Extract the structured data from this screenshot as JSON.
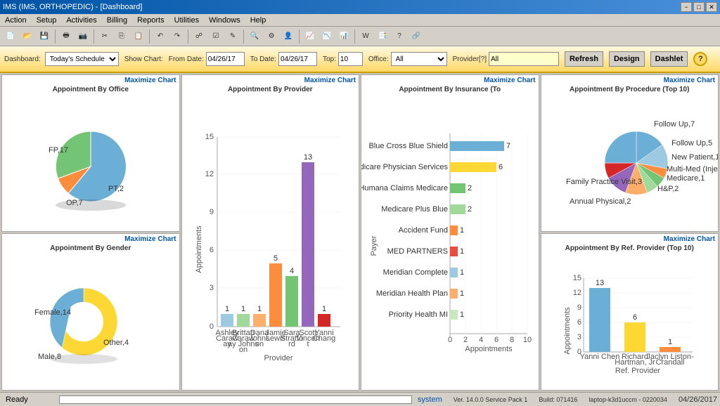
{
  "titleBar": {
    "title": "IMS (IMS, ORTHOPEDIC) - [Dashboard]",
    "buttons": [
      "minimize",
      "restore",
      "close"
    ]
  },
  "menuBar": {
    "items": [
      "Action",
      "Setup",
      "Activities",
      "Billing",
      "Reports",
      "Utilities",
      "Windows",
      "Help"
    ]
  },
  "filterBar": {
    "dashboardLabel": "Dashboard:",
    "dashboardValue": "Today's Schedule",
    "showChartLabel": "Show Chart:",
    "fromDateLabel": "From Date:",
    "fromDateValue": "04/26/17",
    "toDateLabel": "To Date:",
    "toDateValue": "04/26/17",
    "topLabel": "Top:",
    "topValue": "10",
    "officeLabel": "Office:",
    "officeValue": "All",
    "providerLabel": "Provider[?]",
    "providerValue": "All",
    "refreshLabel": "Refresh",
    "designLabel": "Design",
    "dashletLabel": "Dashlet",
    "helpSymbol": "?"
  },
  "charts": {
    "appointmentByOffice": {
      "title": "Appointment By Office",
      "maximize": "Maximize Chart",
      "data": [
        {
          "label": "FP",
          "value": 17,
          "color": "#6baed6"
        },
        {
          "label": "PT",
          "value": 2,
          "color": "#fd8d3c"
        },
        {
          "label": "OP",
          "value": 7,
          "color": "#74c476"
        }
      ]
    },
    "appointmentByProvider": {
      "title": "Appointment By Provider",
      "maximize": "Maximize Chart",
      "xLabel": "Provider",
      "yLabel": "Appointments",
      "data": [
        {
          "label": "Ashley Caraw ay",
          "value": 1,
          "color": "#9ecae1"
        },
        {
          "label": "Brittan Caraw ay Johns on",
          "value": 1,
          "color": "#a1d99b"
        },
        {
          "label": "Dana Johns on",
          "value": 1,
          "color": "#fdae6b"
        },
        {
          "label": "Jamie Lewis",
          "value": 5,
          "color": "#fd8d3c"
        },
        {
          "label": "Sara Stratfo rd",
          "value": 4,
          "color": "#74c476"
        },
        {
          "label": "Scott Vincen t",
          "value": 13,
          "color": "#9467bd"
        },
        {
          "label": "Yanni Chang",
          "value": 1,
          "color": "#d62728"
        }
      ]
    },
    "appointmentByInsurance": {
      "title": "Appointment By Insurance (To",
      "maximize": "Maximize Chart",
      "xLabel": "Appointments",
      "yLabel": "Payer",
      "data": [
        {
          "label": "Blue Cross Blue Shield",
          "value": 7,
          "color": "#6baed6"
        },
        {
          "label": "Medicare Physician Services",
          "value": 6,
          "color": "#fdd835"
        },
        {
          "label": "Humana Claims Medicare",
          "value": 2,
          "color": "#74c476"
        },
        {
          "label": "Medicare Plus Blue",
          "value": 2,
          "color": "#a1d99b"
        },
        {
          "label": "Accident Fund",
          "value": 1,
          "color": "#fd8d3c"
        },
        {
          "label": "MED PARTNERS",
          "value": 1,
          "color": "#e74c3c"
        },
        {
          "label": "Meridian Complete",
          "value": 1,
          "color": "#9ecae1"
        },
        {
          "label": "Meridian Health Plan",
          "value": 1,
          "color": "#fdae6b"
        },
        {
          "label": "Priority Health MI",
          "value": 1,
          "color": "#c7e9c0"
        }
      ]
    },
    "appointmentByProcedure": {
      "title": "Appointment By Procedure (Top 10)",
      "maximize": "Maximize Chart",
      "data": [
        {
          "label": "Follow Up",
          "value": 7,
          "color": "#6baed6"
        },
        {
          "label": "Follow Up",
          "value": 5,
          "color": "#9ecae1"
        },
        {
          "label": "New Patient",
          "value": 1,
          "color": "#fd8d3c"
        },
        {
          "label": "Multi-Med (Injectio",
          "value": 1,
          "color": "#74c476"
        },
        {
          "label": "Medicare",
          "value": 1,
          "color": "#a1d99b"
        },
        {
          "label": "H&P",
          "value": 2,
          "color": "#fdae6b"
        },
        {
          "label": "Annual Physical",
          "value": 2,
          "color": "#9467bd"
        },
        {
          "label": "Family Practice Visit",
          "value": 3,
          "color": "#d62728"
        }
      ]
    },
    "appointmentByGender": {
      "title": "Appointment By Gender",
      "maximize": "Maximize Chart",
      "data": [
        {
          "label": "Female",
          "value": 14,
          "color": "#fdd835"
        },
        {
          "label": "Other",
          "value": 4,
          "color": "#74c476"
        },
        {
          "label": "Male",
          "value": 8,
          "color": "#6baed6"
        }
      ]
    },
    "appointmentByRefProvider": {
      "title": "Appointment By Ref. Provider (Top 10)",
      "maximize": "Maximize Chart",
      "xLabel": "Ref. Provider",
      "yLabel": "Appointments",
      "data": [
        {
          "label": "Yanni Chen",
          "value": 13,
          "color": "#6baed6"
        },
        {
          "label": "Richard Hartman, Jr",
          "value": 6,
          "color": "#fdd835"
        },
        {
          "label": "Jaclyn Liston-Crandall",
          "value": 1,
          "color": "#fd8d3c"
        }
      ]
    }
  },
  "statusBar": {
    "ready": "Ready",
    "system": "system",
    "version": "Ver. 14.0.0 Service Pack 1",
    "build": "Build: 071416",
    "laptop": "laptop-k3d1uccm - 0220034",
    "date": "04/26/2017"
  }
}
